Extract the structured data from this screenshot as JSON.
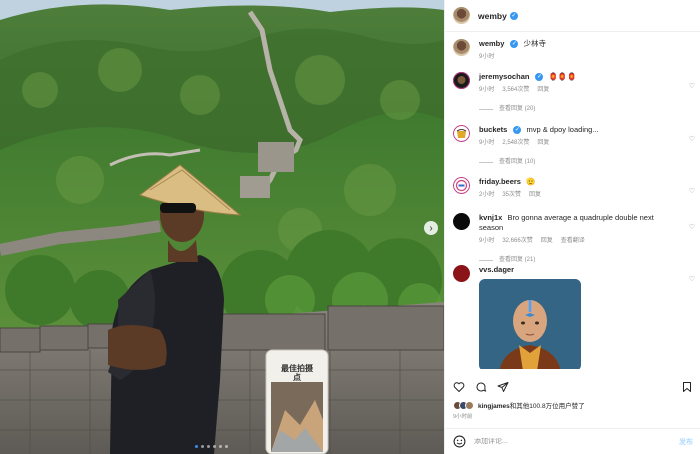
{
  "header": {
    "username": "wemby",
    "verified_icon": "verified-badge-icon"
  },
  "caption": {
    "username": "wemby",
    "text": "少林寺",
    "time": "9小时"
  },
  "comments": [
    {
      "username": "jeremysochan",
      "verified": true,
      "text": "🏮🏮🏮",
      "time": "9小时",
      "likes": "3,564次赞",
      "reply": "回复",
      "view_replies": "查看回复 (20)"
    },
    {
      "username": "buckets",
      "verified": true,
      "text": "mvp & dpoy loading...",
      "time": "9小时",
      "likes": "2,548次赞",
      "reply": "回复",
      "view_replies": "查看回复 (10)"
    },
    {
      "username": "friday.beers",
      "verified": false,
      "text": "🫡",
      "time": "2小时",
      "likes": "35次赞",
      "reply": "回复"
    },
    {
      "username": "kvnj1x",
      "verified": false,
      "text": "Bro gonna average a quadruple double next season",
      "time": "9小时",
      "likes": "32,666次赞",
      "reply": "回复",
      "translate": "查看翻译",
      "view_replies": "查看回复 (21)"
    },
    {
      "username": "vvs.dager",
      "verified": false,
      "text": ""
    }
  ],
  "photo": {
    "sign_text": "最佳拍摄点"
  },
  "likes": {
    "first_user": "kingjames",
    "rest": "和其他100.8万位用户赞了"
  },
  "post_time": "9小时前",
  "add_comment": {
    "placeholder": "添加评论...",
    "post_label": "发布"
  },
  "colors": {
    "verified": "#3897f0",
    "carousel_dot_active": "#3a8ee6"
  }
}
